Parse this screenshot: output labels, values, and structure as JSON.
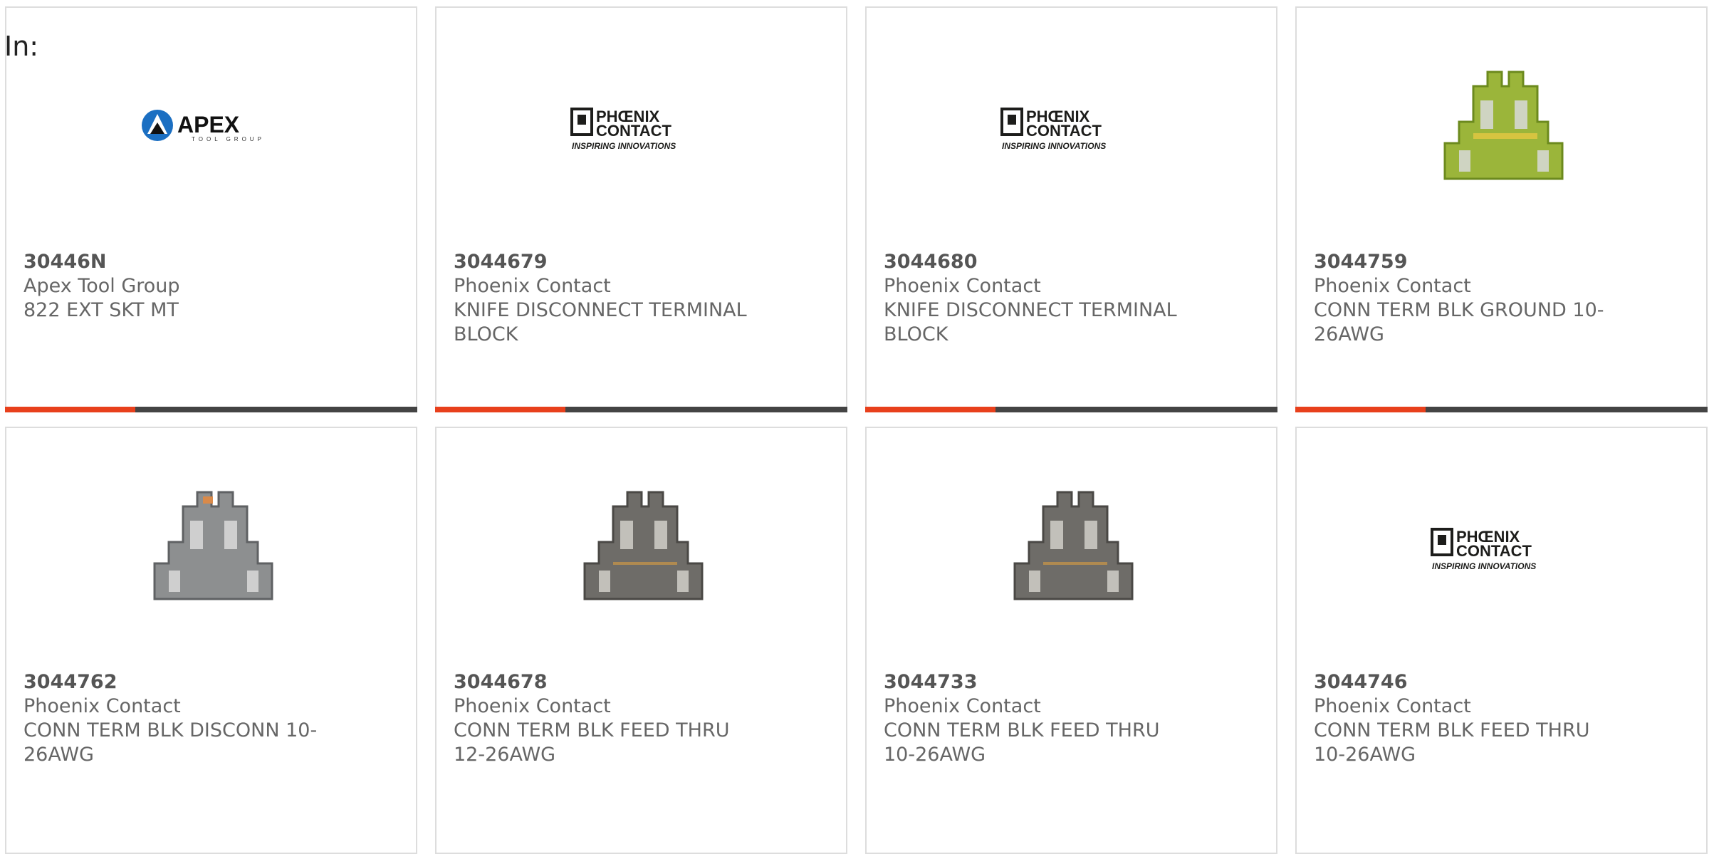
{
  "heading": "In:",
  "colors": {
    "accent": "#e8401c",
    "bar": "#444444",
    "phoenix_dark": "#1d1d1b",
    "apex_blue": "#1b6fc2"
  },
  "brand_logos": {
    "apex": {
      "name": "APEX",
      "tagline": "TOOL GROUP"
    },
    "phoenix": {
      "line1": "PHŒNIX",
      "line2": "CONTACT",
      "tagline": "INSPIRING INNOVATIONS"
    }
  },
  "products": [
    {
      "part_number": "30446N",
      "manufacturer": "Apex Tool Group",
      "description": "822 EXT SKT MT",
      "image": "apex-logo"
    },
    {
      "part_number": "3044679",
      "manufacturer": "Phoenix Contact",
      "description": "KNIFE DISCONNECT TERMINAL BLOCK",
      "image": "phoenix-logo"
    },
    {
      "part_number": "3044680",
      "manufacturer": "Phoenix Contact",
      "description": "KNIFE DISCONNECT TERMINAL BLOCK",
      "image": "phoenix-logo"
    },
    {
      "part_number": "3044759",
      "manufacturer": "Phoenix Contact",
      "description": "CONN TERM BLK GROUND 10-26AWG",
      "image": "terminal-block-green"
    },
    {
      "part_number": "3044762",
      "manufacturer": "Phoenix Contact",
      "description": "CONN TERM BLK DISCONN 10-26AWG",
      "image": "terminal-block-gray"
    },
    {
      "part_number": "3044678",
      "manufacturer": "Phoenix Contact",
      "description": "CONN TERM BLK FEED THRU 12-26AWG",
      "image": "terminal-block-dark"
    },
    {
      "part_number": "3044733",
      "manufacturer": "Phoenix Contact",
      "description": "CONN TERM BLK FEED THRU 10-26AWG",
      "image": "terminal-block-dark"
    },
    {
      "part_number": "3044746",
      "manufacturer": "Phoenix Contact",
      "description": "CONN TERM BLK FEED THRU 10-26AWG",
      "image": "phoenix-logo"
    }
  ]
}
